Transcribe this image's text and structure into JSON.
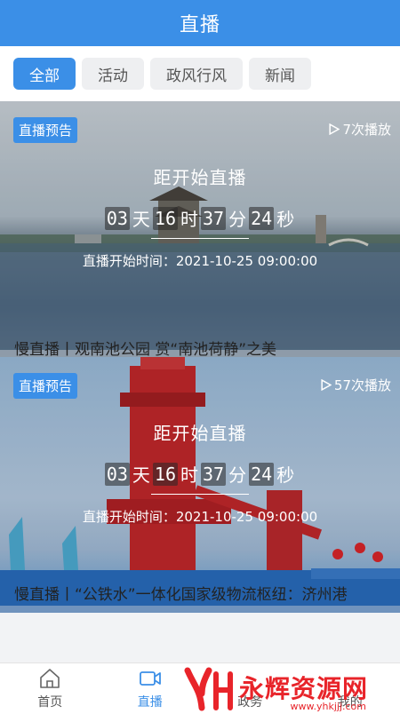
{
  "header": {
    "title": "直播"
  },
  "tabs": [
    {
      "label": "全部",
      "active": true
    },
    {
      "label": "活动",
      "active": false
    },
    {
      "label": "政风行风",
      "active": false
    },
    {
      "label": "新闻",
      "active": false
    }
  ],
  "cards": [
    {
      "badge": "直播预告",
      "plays": "7次播放",
      "countdown_title": "距开始直播",
      "timer": {
        "days": "03",
        "day_unit": "天",
        "hours": "16",
        "hour_unit": "时",
        "minutes": "37",
        "minute_unit": "分",
        "seconds": "24",
        "second_unit": "秒"
      },
      "start_time": "直播开始时间：2021-10-25 09:00:00",
      "title": "慢直播丨观南池公园 赏“南池荷静”之美"
    },
    {
      "badge": "直播预告",
      "plays": "57次播放",
      "countdown_title": "距开始直播",
      "timer": {
        "days": "03",
        "day_unit": "天",
        "hours": "16",
        "hour_unit": "时",
        "minutes": "37",
        "minute_unit": "分",
        "seconds": "24",
        "second_unit": "秒"
      },
      "start_time": "直播开始时间：2021-10-25 09:00:00",
      "title": "慢直播丨“公铁水”一体化国家级物流枢纽：济州港"
    }
  ],
  "bottom_nav": [
    {
      "label": "首页",
      "icon": "home-icon",
      "active": false
    },
    {
      "label": "直播",
      "icon": "video-icon",
      "active": true
    },
    {
      "label": "政务",
      "icon": "gov-icon",
      "active": false
    },
    {
      "label": "我的",
      "icon": "user-icon",
      "active": false
    }
  ],
  "watermark": {
    "text": "永辉资源网",
    "url": "www.yhkjjj.com"
  },
  "colors": {
    "accent": "#3b8fe7",
    "watermark": "#e8242a"
  }
}
